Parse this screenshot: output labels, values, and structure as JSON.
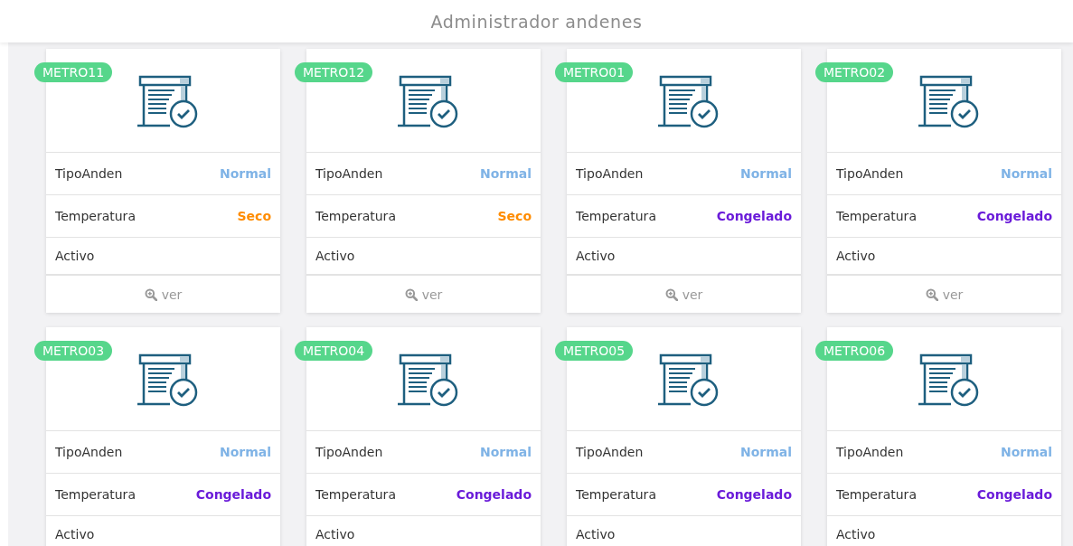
{
  "header": {
    "title": "Administrador andenes"
  },
  "cards": [
    {
      "name": "METRO11",
      "rows": [
        {
          "label": "TipoAnden",
          "value": "Normal",
          "color": "#7fb3e6"
        },
        {
          "label": "Temperatura",
          "value": "Seco",
          "color": "#ff8c00"
        },
        {
          "label": "Activo"
        }
      ],
      "action": "ver"
    },
    {
      "name": "METRO12",
      "rows": [
        {
          "label": "TipoAnden",
          "value": "Normal",
          "color": "#7fb3e6"
        },
        {
          "label": "Temperatura",
          "value": "Seco",
          "color": "#ff8c00"
        },
        {
          "label": "Activo"
        }
      ],
      "action": "ver"
    },
    {
      "name": "METRO01",
      "rows": [
        {
          "label": "TipoAnden",
          "value": "Normal",
          "color": "#7fb3e6"
        },
        {
          "label": "Temperatura",
          "value": "Congelado",
          "color": "#6a1bd9"
        },
        {
          "label": "Activo"
        }
      ],
      "action": "ver"
    },
    {
      "name": "METRO02",
      "rows": [
        {
          "label": "TipoAnden",
          "value": "Normal",
          "color": "#7fb3e6"
        },
        {
          "label": "Temperatura",
          "value": "Congelado",
          "color": "#6a1bd9"
        },
        {
          "label": "Activo"
        }
      ],
      "action": "ver"
    },
    {
      "name": "METRO03",
      "rows": [
        {
          "label": "TipoAnden",
          "value": "Normal",
          "color": "#7fb3e6"
        },
        {
          "label": "Temperatura",
          "value": "Congelado",
          "color": "#6a1bd9"
        },
        {
          "label": "Activo"
        }
      ]
    },
    {
      "name": "METRO04",
      "rows": [
        {
          "label": "TipoAnden",
          "value": "Normal",
          "color": "#7fb3e6"
        },
        {
          "label": "Temperatura",
          "value": "Congelado",
          "color": "#6a1bd9"
        },
        {
          "label": "Activo"
        }
      ]
    },
    {
      "name": "METRO05",
      "rows": [
        {
          "label": "TipoAnden",
          "value": "Normal",
          "color": "#7fb3e6"
        },
        {
          "label": "Temperatura",
          "value": "Congelado",
          "color": "#6a1bd9"
        },
        {
          "label": "Activo"
        }
      ]
    },
    {
      "name": "METRO06",
      "rows": [
        {
          "label": "TipoAnden",
          "value": "Normal",
          "color": "#7fb3e6"
        },
        {
          "label": "Temperatura",
          "value": "Congelado",
          "color": "#6a1bd9"
        },
        {
          "label": "Activo"
        }
      ]
    }
  ]
}
